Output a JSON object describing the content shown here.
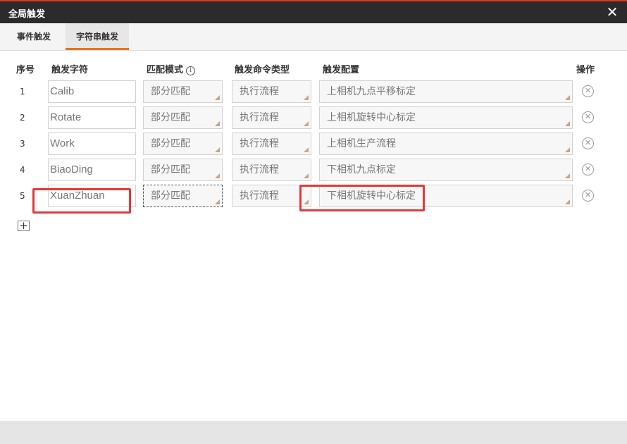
{
  "window": {
    "title": "全局触发",
    "close_glyph": "✕"
  },
  "tabs": [
    {
      "label": "事件触发",
      "active": false
    },
    {
      "label": "字符串触发",
      "active": true
    }
  ],
  "table": {
    "headers": {
      "index": "序号",
      "trigger": "触发字符",
      "mode": "匹配模式",
      "cmd_type": "触发命令类型",
      "config": "触发配置",
      "action": "操作"
    },
    "rows": [
      {
        "index": "1",
        "trigger": "Calib",
        "mode": "部分匹配",
        "cmd_type": "执行流程",
        "config": "上相机九点平移标定"
      },
      {
        "index": "2",
        "trigger": "Rotate",
        "mode": "部分匹配",
        "cmd_type": "执行流程",
        "config": "上相机旋转中心标定"
      },
      {
        "index": "3",
        "trigger": "Work",
        "mode": "部分匹配",
        "cmd_type": "执行流程",
        "config": "上相机生产流程"
      },
      {
        "index": "4",
        "trigger": "BiaoDing",
        "mode": "部分匹配",
        "cmd_type": "执行流程",
        "config": "下相机九点标定"
      },
      {
        "index": "5",
        "trigger": "XuanZhuan",
        "mode": "部分匹配",
        "cmd_type": "执行流程",
        "config": "下相机旋转中心标定"
      }
    ]
  },
  "icons": {
    "info": "info-icon",
    "delete": "circle-x-icon",
    "add": "plus-icon",
    "close": "close-icon"
  },
  "colors": {
    "titlebar": "#2b2b2b",
    "accent": "#e8731b",
    "highlight": "#e53838"
  }
}
